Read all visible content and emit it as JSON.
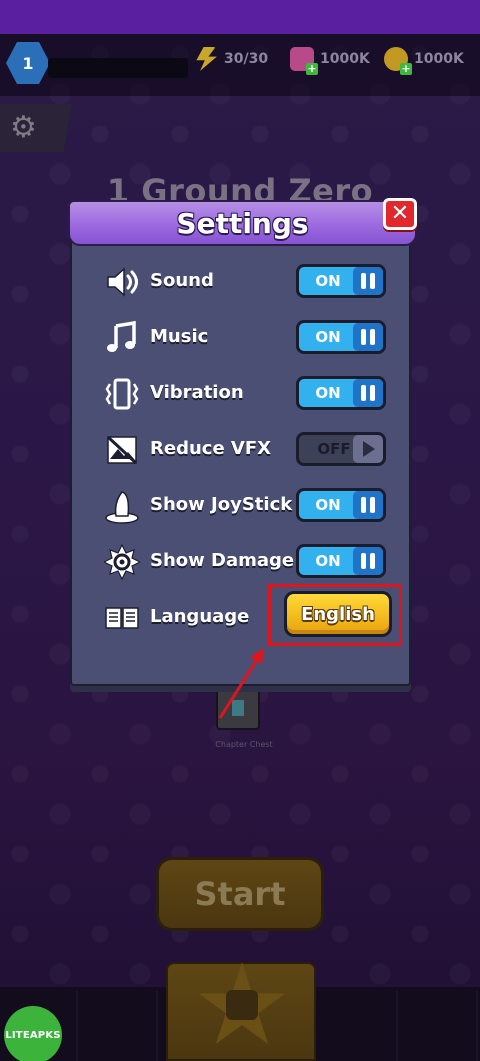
{
  "background": {
    "level": "1",
    "resources": {
      "energy": "30/30",
      "gems": "1000K",
      "coins": "1000K"
    },
    "chapter_title": "1 Ground Zero",
    "chest_label": "Chapter Chest",
    "start_label": "Start"
  },
  "settings": {
    "title": "Settings",
    "close_symbol": "✕",
    "rows": [
      {
        "label": "Sound",
        "state": "ON",
        "icon": "speaker-icon"
      },
      {
        "label": "Music",
        "state": "ON",
        "icon": "music-note-icon"
      },
      {
        "label": "Vibration",
        "state": "ON",
        "icon": "vibration-icon"
      },
      {
        "label": "Reduce VFX",
        "state": "OFF",
        "icon": "image-off-icon"
      },
      {
        "label": "Show JoyStick",
        "state": "ON",
        "icon": "joystick-icon"
      },
      {
        "label": "Show Damage",
        "state": "ON",
        "icon": "damage-burst-icon"
      }
    ],
    "language": {
      "label": "Language",
      "value": "English",
      "icon": "book-icon"
    }
  },
  "watermark": "LITEAPKS",
  "colors": {
    "dialog_bg": "#4a4f73",
    "header_purple": "#9c6ae0",
    "toggle_on": "#33b1ef",
    "toggle_off": "#3d4158",
    "language_button": "#f2b91a",
    "close_button": "#e0282d",
    "annotation_red": "#e0141c"
  }
}
